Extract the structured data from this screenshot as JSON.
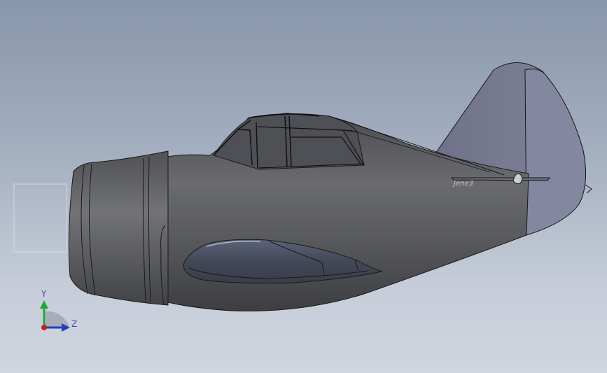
{
  "viewport": {
    "background_top": "#8896ab",
    "background_bottom": "#d0d6df"
  },
  "model": {
    "body_color": "#5a5b5f",
    "tail_color": "#7d7f92",
    "edge_color": "#1a1a1a",
    "fuselage_text": "Jene3"
  },
  "triad": {
    "y_label": "Y",
    "z_label": "Z",
    "y_color": "#1fa83a",
    "z_color": "#2040c0",
    "origin_color": "#c02020"
  }
}
